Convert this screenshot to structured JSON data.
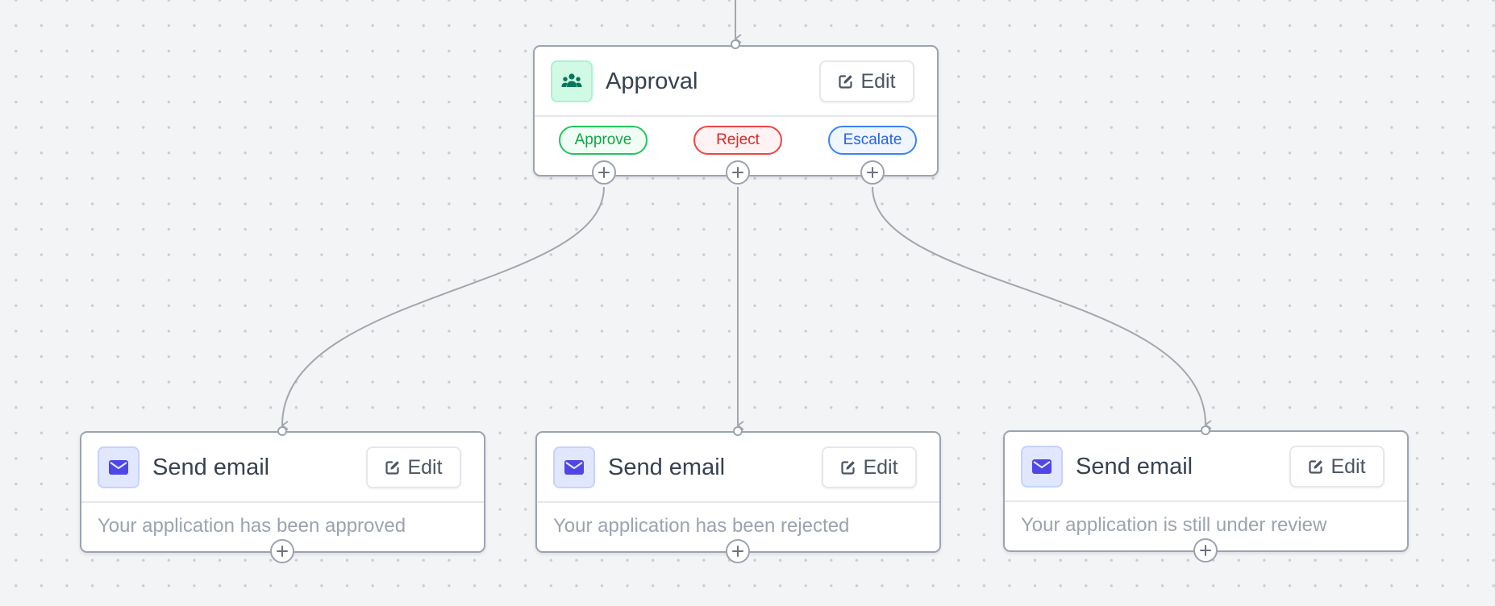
{
  "approval_node": {
    "title": "Approval",
    "icon": "people-group-icon",
    "edit_label": "Edit",
    "branches": [
      {
        "label": "Approve",
        "color": "#22c55e"
      },
      {
        "label": "Reject",
        "color": "#ef4444"
      },
      {
        "label": "Escalate",
        "color": "#3b82f6"
      }
    ]
  },
  "email_nodes": [
    {
      "title": "Send email",
      "icon": "envelope-icon",
      "edit_label": "Edit",
      "message": "Your application has been approved"
    },
    {
      "title": "Send email",
      "icon": "envelope-icon",
      "edit_label": "Edit",
      "message": "Your application has been rejected"
    },
    {
      "title": "Send email",
      "icon": "envelope-icon",
      "edit_label": "Edit",
      "message": "Your application is still under review"
    }
  ],
  "colors": {
    "canvas_background": "#f3f4f6",
    "node_border": "#9ca3af",
    "edge": "#a3a6ad",
    "approval_icon_bg": "#d1fae5",
    "email_icon_bg": "#e0e7ff",
    "email_icon": "#4f46e5"
  }
}
